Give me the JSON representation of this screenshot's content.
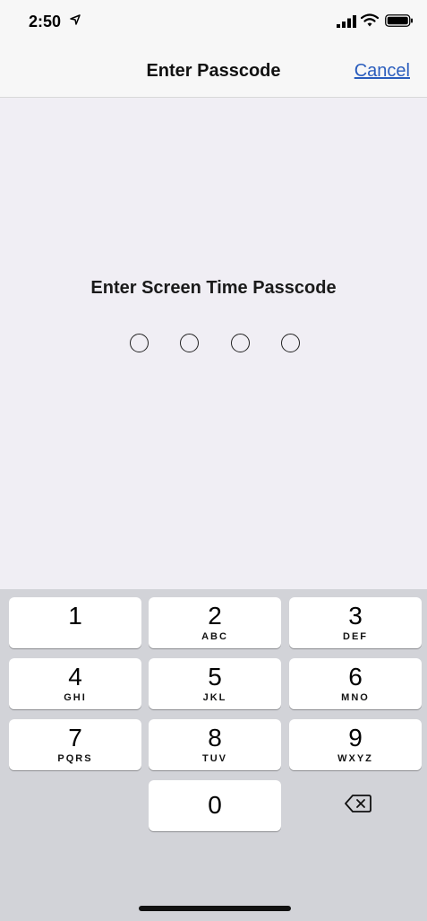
{
  "status_bar": {
    "time": "2:50",
    "icons": [
      "location-arrow-icon",
      "signal-bars-icon",
      "wifi-icon",
      "battery-icon"
    ]
  },
  "nav": {
    "title": "Enter Passcode",
    "cancel_label": "Cancel"
  },
  "prompt": "Enter Screen Time Passcode",
  "passcode": {
    "length": 4,
    "entered": 0
  },
  "keypad": {
    "keys": [
      {
        "digit": "1",
        "letters": ""
      },
      {
        "digit": "2",
        "letters": "ABC"
      },
      {
        "digit": "3",
        "letters": "DEF"
      },
      {
        "digit": "4",
        "letters": "GHI"
      },
      {
        "digit": "5",
        "letters": "JKL"
      },
      {
        "digit": "6",
        "letters": "MNO"
      },
      {
        "digit": "7",
        "letters": "PQRS"
      },
      {
        "digit": "8",
        "letters": "TUV"
      },
      {
        "digit": "9",
        "letters": "WXYZ"
      },
      {
        "digit": "0",
        "letters": ""
      }
    ],
    "delete_icon": "delete-backspace-icon"
  },
  "colors": {
    "accent": "#2a5dbd",
    "background": "#f0eef4",
    "keypad_background": "#d2d3d8"
  }
}
